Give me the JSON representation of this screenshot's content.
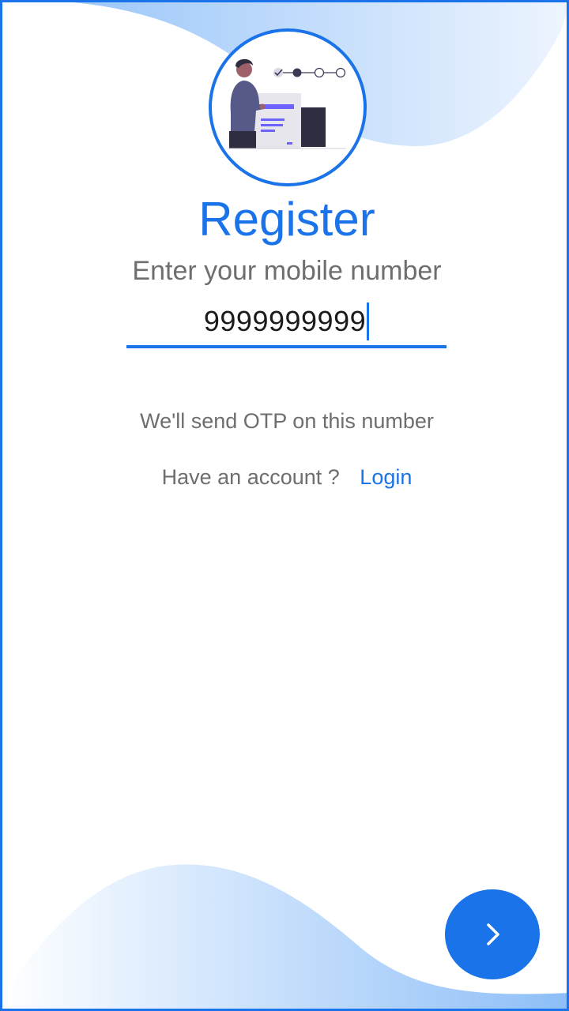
{
  "header": {
    "title": "Register",
    "subtitle": "Enter your mobile number"
  },
  "form": {
    "phone_value": "9999999999"
  },
  "notes": {
    "otp": "We'll send OTP on this number",
    "account_question": "Have an account ?",
    "login_label": "Login"
  },
  "icons": {
    "next": "chevron-right-icon",
    "illustration": "registration-illustration"
  },
  "colors": {
    "accent": "#1a73e8",
    "wave_light": "#dcecfd",
    "wave_mid": "#a9cdfb",
    "text_muted": "#6e6e6e"
  }
}
